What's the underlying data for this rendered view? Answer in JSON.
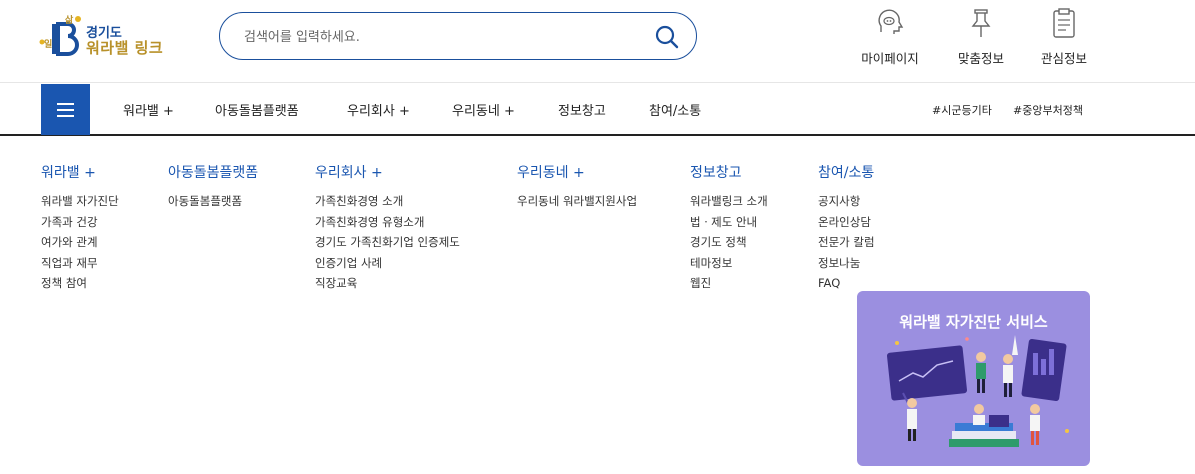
{
  "logo": {
    "line1": "경기도",
    "line2": "워라밸 링크",
    "mark_top": "삶",
    "mark_left": "일"
  },
  "search": {
    "placeholder": "검색어를 입력하세요."
  },
  "utility": [
    {
      "label": "마이페이지",
      "icon": "user-head-icon"
    },
    {
      "label": "맞춤정보",
      "icon": "pin-icon"
    },
    {
      "label": "관심정보",
      "icon": "clipboard-icon"
    }
  ],
  "nav": {
    "items": [
      {
        "label": "워라밸 +"
      },
      {
        "label": "아동돌봄플랫폼"
      },
      {
        "label": "우리회사 +"
      },
      {
        "label": "우리동네 +"
      },
      {
        "label": "정보창고"
      },
      {
        "label": "참여/소통"
      }
    ],
    "tags": [
      "#시군등기타",
      "#중앙부처정책"
    ]
  },
  "mega": [
    {
      "title": "워라밸 +",
      "links": [
        "워라밸 자가진단",
        "가족과 건강",
        "여가와 관계",
        "직업과 재무",
        "정책 참여"
      ]
    },
    {
      "title": "아동돌봄플랫폼",
      "links": [
        "아동돌봄플랫폼"
      ]
    },
    {
      "title": "우리회사 +",
      "links": [
        "가족친화경영 소개",
        "가족친화경영 유형소개",
        "경기도 가족친화기업 인증제도",
        "인증기업 사례",
        "직장교육"
      ]
    },
    {
      "title": "우리동네 +",
      "links": [
        "우리동네 워라밸지원사업"
      ]
    },
    {
      "title": "정보창고",
      "links": [
        "워라밸링크 소개",
        "법ㆍ제도 안내",
        "경기도 정책",
        "테마정보",
        "웹진"
      ]
    },
    {
      "title": "참여/소통",
      "links": [
        "공지사항",
        "온라인상담",
        "전문가 칼럼",
        "정보나눔",
        "FAQ"
      ]
    }
  ],
  "banner": {
    "title": "워라밸 자가진단 서비스"
  },
  "colors": {
    "primary": "#1a56b0",
    "gold": "#b8912a",
    "banner": "#9b8fe0"
  }
}
